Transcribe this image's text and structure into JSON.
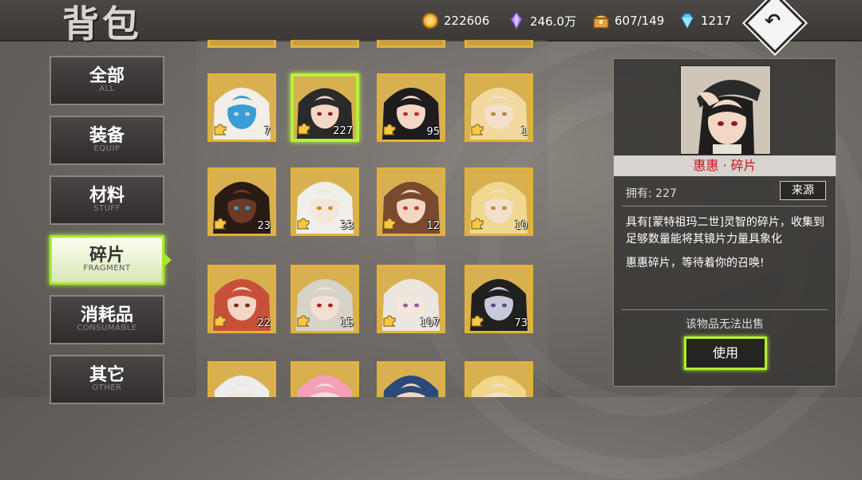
{
  "header": {
    "title": "背包",
    "resources": [
      {
        "icon": "gold-coin-icon",
        "value": "222606"
      },
      {
        "icon": "purple-crystal-icon",
        "value": "246.0万"
      },
      {
        "icon": "treasure-chest-icon",
        "value": "607/149"
      },
      {
        "icon": "blue-diamond-icon",
        "value": "1217"
      }
    ],
    "back_icon": "back-arrow-icon"
  },
  "tabs": [
    {
      "cn": "全部",
      "en": "ALL",
      "active": false
    },
    {
      "cn": "装备",
      "en": "EQUIP",
      "active": false
    },
    {
      "cn": "材料",
      "en": "STUFF",
      "active": false
    },
    {
      "cn": "碎片",
      "en": "FRAGMENT",
      "active": true
    },
    {
      "cn": "消耗品",
      "en": "CONSUMABLE",
      "active": false
    },
    {
      "cn": "其它",
      "en": "OTHER",
      "active": false
    }
  ],
  "grid": {
    "rows": [
      [
        {
          "count": "7"
        },
        {
          "count": "227",
          "selected": true
        },
        {
          "count": "95"
        },
        {
          "count": "1"
        }
      ],
      [
        {
          "count": "23"
        },
        {
          "count": "33"
        },
        {
          "count": "12"
        },
        {
          "count": "10"
        }
      ],
      [
        {
          "count": "22"
        },
        {
          "count": "15"
        },
        {
          "count": "107"
        },
        {
          "count": "73"
        }
      ],
      [
        {
          "count": ""
        },
        {
          "count": ""
        },
        {
          "count": ""
        },
        {
          "count": ""
        }
      ]
    ]
  },
  "detail": {
    "name": "惠惠 · 碎片",
    "owned_label": "拥有: 227",
    "source_button": "来源",
    "description": "具有[蒙特祖玛二世]灵智的碎片，收集到足够数量能将其镜片力量具象化",
    "flavor": "惠惠碎片，等待着你的召唤!",
    "sell_notice": "该物品无法出售",
    "use_button": "使用"
  },
  "colors": {
    "accent_green": "#b3ee2e",
    "card_gold": "#e0b33a",
    "name_red": "#c4121a"
  }
}
